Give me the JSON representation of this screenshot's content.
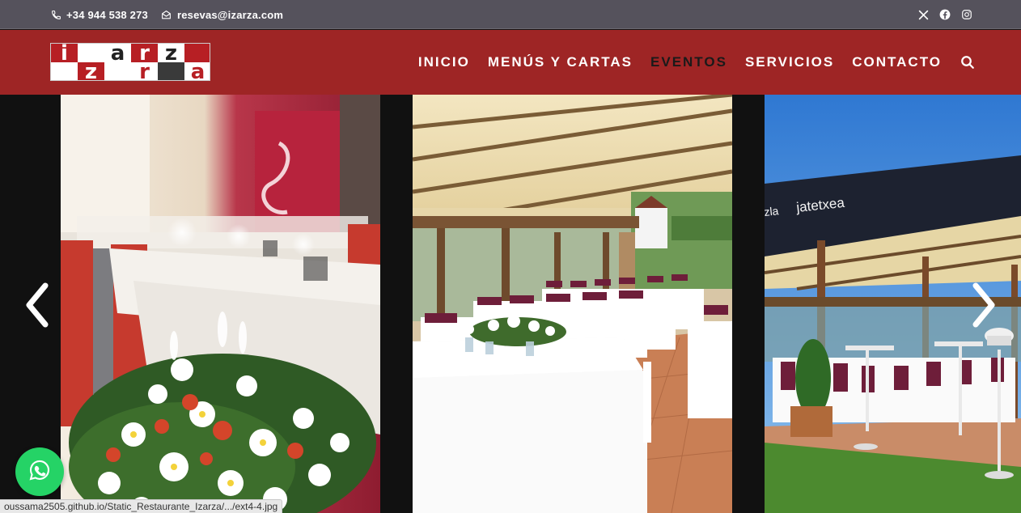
{
  "topbar": {
    "phone": "+34 944 538 273",
    "email": "resevas@izarza.com",
    "social_icons": [
      "x-icon",
      "facebook-icon",
      "instagram-icon"
    ]
  },
  "logo": {
    "letters_top": [
      "i",
      "z",
      "a",
      "r",
      "z",
      "a"
    ],
    "letters_bottom": [
      "z",
      "a",
      "r",
      "z",
      "a"
    ],
    "alt": "izarza"
  },
  "nav": {
    "items": [
      {
        "label": "INICIO",
        "active": false
      },
      {
        "label": "MENÚS Y CARTAS",
        "active": false
      },
      {
        "label": "EVENTOS",
        "active": true
      },
      {
        "label": "SERVICIOS",
        "active": false
      },
      {
        "label": "CONTACTO",
        "active": false
      }
    ],
    "search_icon": "search-icon"
  },
  "carousel": {
    "slides": [
      {
        "name": "indoor-banquet-table-with-flowers"
      },
      {
        "name": "terrace-under-awning-with-tables"
      },
      {
        "name": "garden-terrace-jatetxea"
      }
    ],
    "signage_text": "jatetxea",
    "signage_prefix": "zla",
    "prev_icon": "chevron-left-icon",
    "next_icon": "chevron-right-icon"
  },
  "whatsapp": {
    "icon": "whatsapp-icon"
  },
  "status_bar": {
    "url": "oussama2505.github.io/Static_Restaurante_Izarza/.../ext4-4.jpg"
  },
  "colors": {
    "topbar": "#55525c",
    "navbar": "#9e2525",
    "whatsapp": "#25d366",
    "active_nav": "#1a1a1a"
  }
}
